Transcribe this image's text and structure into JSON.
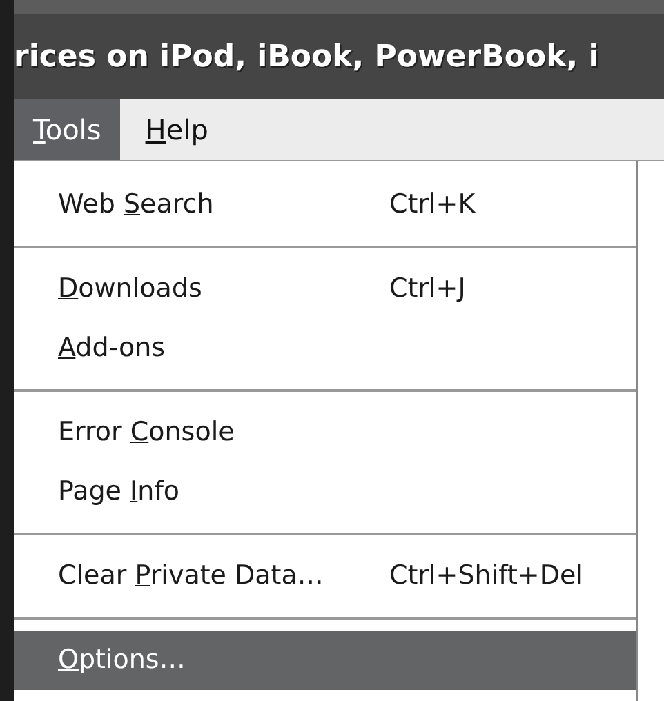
{
  "window": {
    "title": "rices on iPod, iBook, PowerBook, i"
  },
  "menubar": [
    {
      "key": "T",
      "after": "ools",
      "selected": true
    },
    {
      "key": "H",
      "after": "elp",
      "selected": false
    }
  ],
  "menu": {
    "groups": [
      [
        {
          "before": "Web ",
          "key": "S",
          "after": "earch",
          "shortcut": "Ctrl+K",
          "selected": false
        }
      ],
      [
        {
          "key": "D",
          "after": "ownloads",
          "shortcut": "Ctrl+J",
          "selected": false
        },
        {
          "key": "A",
          "after": "dd-ons",
          "selected": false
        }
      ],
      [
        {
          "before": "Error ",
          "key": "C",
          "after": "onsole",
          "selected": false
        },
        {
          "before": "Page ",
          "key": "I",
          "after": "nfo",
          "selected": false
        }
      ],
      [
        {
          "before": "Clear ",
          "key": "P",
          "after": "rivate Data…",
          "shortcut": "Ctrl+Shift+Del",
          "selected": false
        }
      ],
      [
        {
          "key": "O",
          "after": "ptions…",
          "selected": true
        }
      ]
    ]
  }
}
